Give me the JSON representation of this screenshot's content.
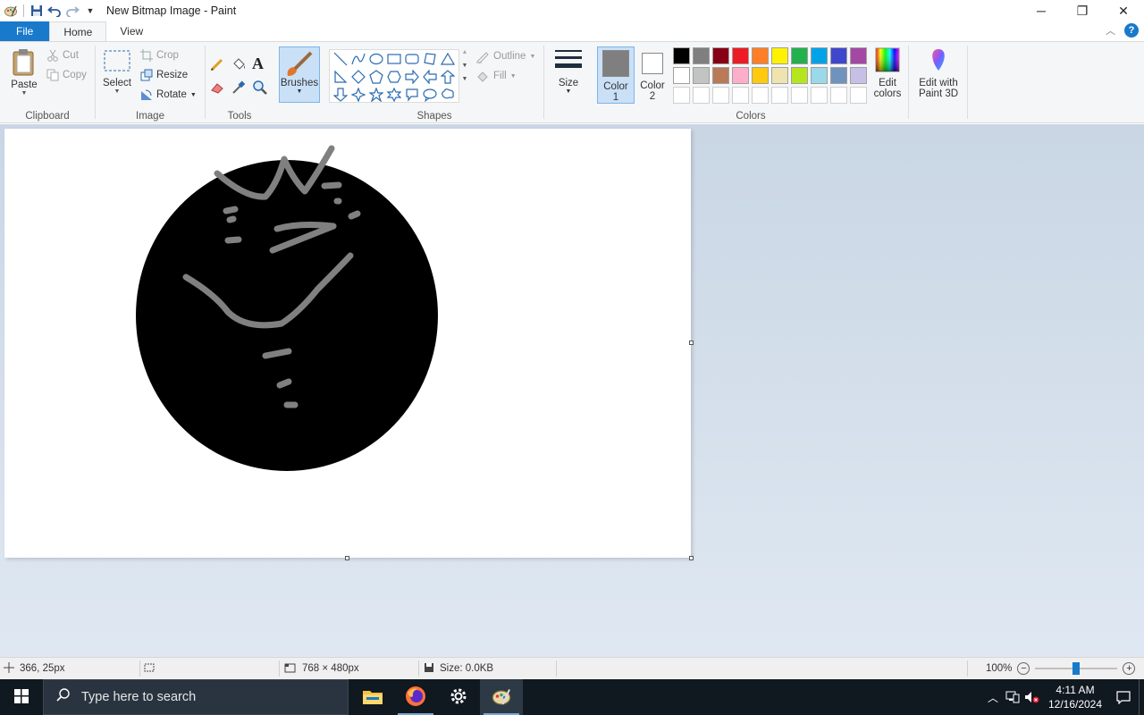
{
  "window": {
    "title": "New Bitmap Image - Paint",
    "controls": {
      "minimize": "─",
      "restore": "❐",
      "close": "✕"
    }
  },
  "tabs": {
    "file": "File",
    "home": "Home",
    "view": "View"
  },
  "ribbon": {
    "clipboard": {
      "label": "Clipboard",
      "paste": "Paste",
      "cut": "Cut",
      "copy": "Copy"
    },
    "image": {
      "label": "Image",
      "select": "Select",
      "crop": "Crop",
      "resize": "Resize",
      "rotate": "Rotate"
    },
    "tools": {
      "label": "Tools"
    },
    "brushes": {
      "label": "Brushes"
    },
    "shapes": {
      "label": "Shapes",
      "outline": "Outline",
      "fill": "Fill"
    },
    "size": {
      "label": "Size"
    },
    "colors": {
      "label": "Colors",
      "color1": "Color\n1",
      "color1_a": "Color",
      "color1_b": "1",
      "color2_a": "Color",
      "color2_b": "2",
      "color1_value": "#7f7f7f",
      "color2_value": "#ffffff",
      "palette_row1": [
        "#000000",
        "#7f7f7f",
        "#880015",
        "#ed1c24",
        "#ff7f27",
        "#fff200",
        "#22b14c",
        "#00a2e8",
        "#3f48cc",
        "#a349a4"
      ],
      "palette_row2": [
        "#ffffff",
        "#c3c3c3",
        "#b97a57",
        "#ffaec9",
        "#ffc90e",
        "#efe4b0",
        "#b5e61d",
        "#99d9ea",
        "#7092be",
        "#c8bfe7"
      ],
      "edit_colors_a": "Edit",
      "edit_colors_b": "colors"
    },
    "paint3d": {
      "line1": "Edit with",
      "line2": "Paint 3D"
    }
  },
  "status": {
    "cursor": "366, 25px",
    "dimensions": "768 × 480px",
    "size": "Size: 0.0KB",
    "zoom": "100%",
    "zoom_level_percent": 100
  },
  "taskbar": {
    "search_placeholder": "Type here to search",
    "time": "4:11 AM",
    "date": "12/16/2024"
  }
}
